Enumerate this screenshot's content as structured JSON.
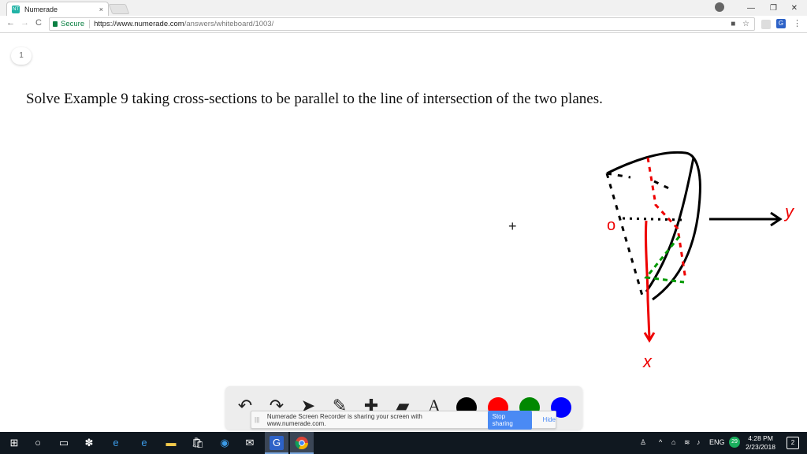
{
  "browser": {
    "tab_title": "Numerade",
    "tab_favicon": "NT",
    "tab_close": "×",
    "secure_label": "Secure",
    "url_main": "https://www.numerade.com",
    "url_rest": "/answers/whiteboard/1003/",
    "minimize": "—",
    "restore": "❐",
    "close": "✕",
    "back": "←",
    "forward": "→",
    "reload": "C",
    "camera_icon": "■",
    "star_icon": "☆",
    "menu_icon": "⋮",
    "ext_letter": "G"
  },
  "whiteboard": {
    "page_number": "1",
    "problem_text": "Solve Example 9 taking cross-sections to be parallel to the line of intersection of the two planes.",
    "cursor_glyph": "+",
    "sketch_labels": {
      "origin": "o",
      "y_axis": "y",
      "x_axis": "x"
    }
  },
  "palette": {
    "tools": [
      {
        "name": "undo",
        "glyph": "↶"
      },
      {
        "name": "redo",
        "glyph": "↷"
      },
      {
        "name": "select",
        "glyph": "➤"
      },
      {
        "name": "pen",
        "glyph": "✎"
      },
      {
        "name": "add",
        "glyph": "✚"
      },
      {
        "name": "eraser",
        "glyph": "▰"
      },
      {
        "name": "text",
        "glyph": "A"
      }
    ],
    "colors": [
      "#000000",
      "#ff0000",
      "#008800",
      "#0000ff"
    ]
  },
  "recorder": {
    "grip": "|||",
    "message": "Numerade Screen Recorder is sharing your screen with www.numerade.com.",
    "stop_label": "Stop sharing",
    "hide_label": "Hide"
  },
  "taskbar": {
    "start_icon": "⊞",
    "search_icon": "○",
    "taskview_icon": "▭",
    "tray_people": "♙",
    "tray_chevron": "^",
    "tray_wifi": "≋",
    "tray_volume": "♪",
    "language": "ENG",
    "badge": "29",
    "time": "4:28 PM",
    "date": "2/23/2018",
    "notifications": "2"
  }
}
